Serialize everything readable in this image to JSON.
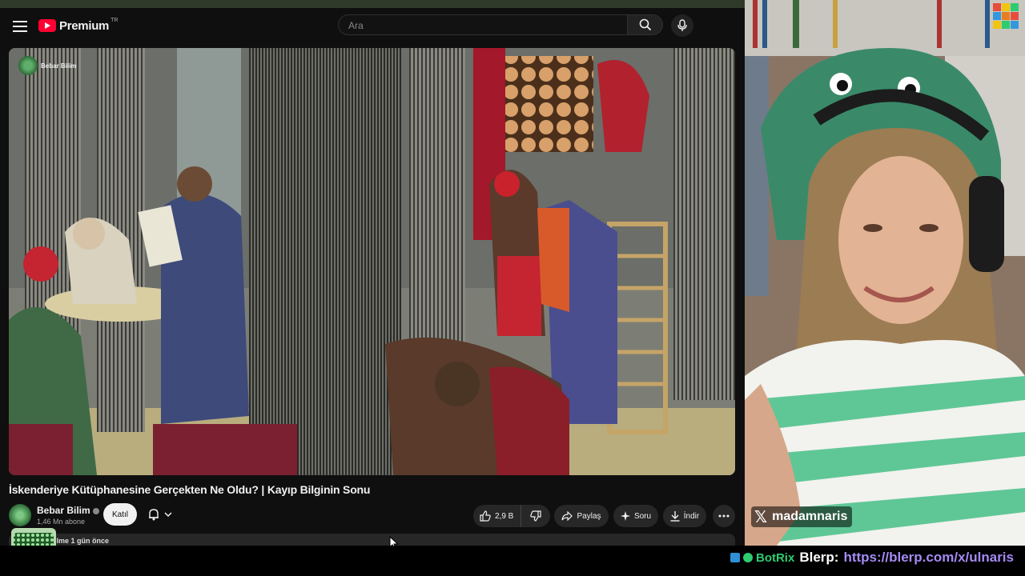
{
  "header": {
    "brand": "Premium",
    "country_code": "TR",
    "search_placeholder": "Ara",
    "icons": [
      "menu-icon",
      "youtube-logo",
      "search-icon",
      "mic-icon"
    ]
  },
  "video": {
    "overlay_channel_name": "Bebar Bilim",
    "title": "İskenderiye Kütüphanesine Gerçekten Ne Oldu? | Kayıp Bilginin Sonu"
  },
  "owner": {
    "channel_name": "Bebar Bilim",
    "subscribers": "1,46 Mn abone",
    "join_label": "Katıl"
  },
  "actions": {
    "like_count": "2,9 B",
    "share_label": "Paylaş",
    "ask_label": "Soru",
    "download_label": "İndir"
  },
  "description": {
    "partial_text": "ilme  1 gün önce"
  },
  "stream": {
    "streamer_handle": "madamnaris",
    "chat_bot_name": "BotRix",
    "chat_message": "Blerp:",
    "chat_link": "https://blerp.com/x/ulnaris"
  },
  "colors": {
    "youtube_red": "#ff0033",
    "background": "#0f0f0f",
    "bot_green": "#2ecc71",
    "link_purple": "#a48bf5"
  }
}
